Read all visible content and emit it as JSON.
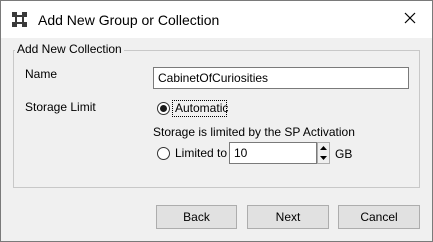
{
  "window": {
    "title": "Add New Group or Collection",
    "icon": "puzzle-app-icon",
    "close_icon": "close-icon"
  },
  "group": {
    "legend": "Add New Collection"
  },
  "name_field": {
    "label": "Name",
    "value": "CabinetOfCuriosities"
  },
  "storage": {
    "label": "Storage Limit",
    "automatic_label": "Automatic",
    "automatic_selected": true,
    "note": "Storage is limited by the SP Activation",
    "limited_label": "Limited to",
    "limited_selected": false,
    "limited_value": "10",
    "unit": "GB"
  },
  "buttons": {
    "back": "Back",
    "next": "Next",
    "cancel": "Cancel"
  }
}
